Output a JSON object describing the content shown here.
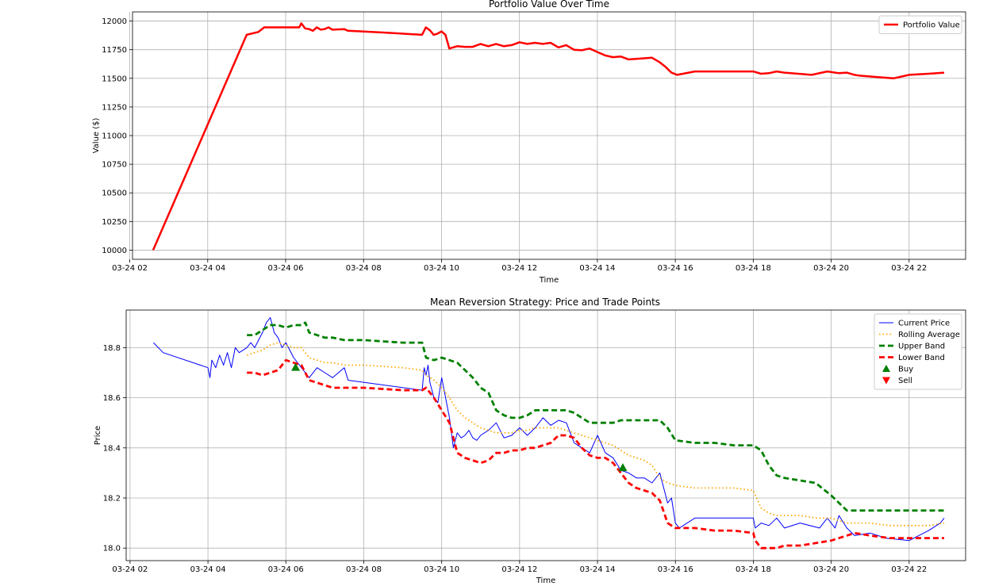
{
  "chart_data": [
    {
      "type": "line",
      "title": "Portfolio Value Over Time",
      "xlabel": "Time",
      "ylabel": "Value ($)",
      "ylim": [
        9920,
        12080
      ],
      "xlim": [
        2.07,
        23.45
      ],
      "x_ticks": [
        2,
        4,
        6,
        8,
        10,
        12,
        14,
        16,
        18,
        20,
        22
      ],
      "x_tick_labels": [
        "03-24 02",
        "03-24 04",
        "03-24 06",
        "03-24 08",
        "03-24 10",
        "03-24 12",
        "03-24 14",
        "03-24 16",
        "03-24 18",
        "03-24 20",
        "03-24 22"
      ],
      "y_ticks": [
        10000,
        10250,
        10500,
        10750,
        11000,
        11250,
        11500,
        11750,
        12000
      ],
      "y_tick_labels": [
        "10000",
        "10250",
        "10500",
        "10750",
        "11000",
        "11250",
        "11500",
        "11750",
        "12000"
      ],
      "grid": true,
      "legend_position": "top-right",
      "series": [
        {
          "name": "Portfolio Value",
          "color": "#ff0000",
          "x": [
            2.6,
            5.0,
            5.3,
            5.45,
            6.35,
            6.4,
            6.5,
            6.6,
            6.7,
            6.8,
            6.9,
            7.0,
            7.1,
            7.2,
            7.5,
            7.6,
            8.5,
            9.5,
            9.6,
            9.7,
            9.8,
            9.9,
            10.0,
            10.1,
            10.2,
            10.4,
            10.6,
            10.8,
            11.0,
            11.2,
            11.4,
            11.6,
            11.8,
            12.0,
            12.2,
            12.4,
            12.6,
            12.8,
            13.0,
            13.2,
            13.4,
            13.6,
            13.8,
            14.0,
            14.2,
            14.4,
            14.6,
            14.8,
            15.0,
            15.4,
            15.6,
            15.75,
            15.9,
            16.05,
            16.5,
            17.0,
            17.5,
            18.0,
            18.2,
            18.4,
            18.6,
            18.8,
            19.5,
            19.9,
            20.2,
            20.4,
            20.6,
            20.7,
            21.2,
            21.6,
            22.0,
            22.5,
            22.9
          ],
          "values": [
            10000,
            11880,
            11905,
            11945,
            11945,
            11980,
            11935,
            11930,
            11915,
            11945,
            11925,
            11930,
            11945,
            11925,
            11930,
            11915,
            11900,
            11880,
            11945,
            11920,
            11880,
            11890,
            11910,
            11880,
            11760,
            11780,
            11775,
            11775,
            11800,
            11780,
            11800,
            11780,
            11790,
            11815,
            11800,
            11810,
            11800,
            11810,
            11770,
            11790,
            11750,
            11745,
            11760,
            11730,
            11700,
            11685,
            11690,
            11665,
            11670,
            11680,
            11640,
            11600,
            11550,
            11530,
            11560,
            11560,
            11560,
            11560,
            11540,
            11545,
            11560,
            11550,
            11530,
            11560,
            11545,
            11550,
            11530,
            11525,
            11510,
            11500,
            11530,
            11540,
            11550
          ]
        }
      ]
    },
    {
      "type": "line",
      "title": "Mean Reversion Strategy: Price and Trade Points",
      "xlabel": "Time",
      "ylabel": "Price",
      "ylim": [
        17.95,
        18.95
      ],
      "xlim": [
        1.9,
        23.45
      ],
      "x_ticks": [
        2,
        4,
        6,
        8,
        10,
        12,
        14,
        16,
        18,
        20,
        22
      ],
      "x_tick_labels": [
        "03-24 02",
        "03-24 04",
        "03-24 06",
        "03-24 08",
        "03-24 10",
        "03-24 12",
        "03-24 14",
        "03-24 16",
        "03-24 18",
        "03-24 20",
        "03-24 22"
      ],
      "y_ticks": [
        18.0,
        18.2,
        18.4,
        18.6,
        18.8
      ],
      "y_tick_labels": [
        "18.0",
        "18.2",
        "18.4",
        "18.6",
        "18.8"
      ],
      "grid": true,
      "legend_position": "top-right",
      "series": [
        {
          "name": "Current Price",
          "color": "#0000ff",
          "style": "solid-thin",
          "x": [
            2.6,
            2.85,
            4.0,
            4.05,
            4.1,
            4.2,
            4.3,
            4.4,
            4.5,
            4.6,
            4.7,
            4.8,
            5.0,
            5.1,
            5.2,
            5.3,
            5.4,
            5.5,
            5.6,
            5.7,
            5.8,
            5.9,
            6.0,
            6.2,
            6.4,
            6.6,
            6.8,
            7.0,
            7.2,
            7.5,
            7.6,
            9.5,
            9.55,
            9.6,
            9.65,
            9.7,
            9.8,
            9.9,
            10.0,
            10.1,
            10.2,
            10.3,
            10.4,
            10.5,
            10.6,
            10.7,
            10.8,
            10.9,
            11.0,
            11.2,
            11.4,
            11.6,
            11.8,
            12.0,
            12.2,
            12.4,
            12.6,
            12.8,
            13.0,
            13.2,
            13.4,
            13.6,
            13.8,
            14.0,
            14.2,
            14.4,
            14.6,
            14.8,
            15.0,
            15.2,
            15.4,
            15.6,
            15.8,
            15.9,
            16.0,
            16.1,
            16.5,
            17.0,
            17.5,
            18.0,
            18.05,
            18.2,
            18.4,
            18.6,
            18.8,
            19.2,
            19.7,
            19.9,
            20.1,
            20.2,
            20.4,
            20.6,
            21.0,
            21.4,
            22.0,
            22.5,
            22.8,
            22.9
          ],
          "values": [
            18.82,
            18.78,
            18.72,
            18.68,
            18.75,
            18.72,
            18.77,
            18.73,
            18.78,
            18.72,
            18.8,
            18.78,
            18.8,
            18.82,
            18.8,
            18.83,
            18.86,
            18.9,
            18.92,
            18.86,
            18.84,
            18.8,
            18.82,
            18.76,
            18.72,
            18.68,
            18.72,
            18.7,
            18.68,
            18.72,
            18.67,
            18.63,
            18.72,
            18.69,
            18.73,
            18.66,
            18.6,
            18.58,
            18.68,
            18.6,
            18.52,
            18.4,
            18.46,
            18.44,
            18.45,
            18.47,
            18.44,
            18.43,
            18.45,
            18.47,
            18.5,
            18.44,
            18.45,
            18.48,
            18.45,
            18.48,
            18.52,
            18.49,
            18.51,
            18.5,
            18.42,
            18.4,
            18.38,
            18.45,
            18.38,
            18.36,
            18.31,
            18.3,
            18.28,
            18.28,
            18.26,
            18.3,
            18.18,
            18.2,
            18.1,
            18.08,
            18.12,
            18.12,
            18.12,
            18.12,
            18.08,
            18.1,
            18.09,
            18.12,
            18.08,
            18.1,
            18.08,
            18.12,
            18.08,
            18.13,
            18.08,
            18.05,
            18.06,
            18.04,
            18.03,
            18.07,
            18.1,
            18.12
          ]
        },
        {
          "name": "Rolling Average",
          "color": "#ffa500",
          "style": "dotted",
          "x": [
            5.0,
            5.2,
            5.4,
            5.6,
            5.8,
            6.0,
            6.2,
            6.4,
            6.5,
            6.6,
            6.8,
            7.0,
            7.2,
            7.5,
            8.0,
            9.0,
            9.5,
            9.6,
            9.8,
            10.0,
            10.2,
            10.4,
            10.6,
            10.8,
            11.0,
            11.2,
            11.4,
            11.6,
            11.8,
            12.0,
            12.2,
            12.4,
            12.6,
            12.8,
            13.0,
            13.2,
            13.4,
            13.6,
            13.8,
            14.0,
            14.2,
            14.4,
            14.6,
            14.8,
            15.0,
            15.2,
            15.4,
            15.6,
            15.8,
            16.0,
            16.5,
            17.0,
            17.5,
            18.0,
            18.2,
            18.4,
            18.6,
            18.8,
            19.2,
            19.6,
            20.0,
            20.2,
            20.4,
            20.6,
            21.0,
            21.5,
            22.0,
            22.5,
            22.9
          ],
          "values": [
            18.77,
            18.78,
            18.79,
            18.81,
            18.82,
            18.81,
            18.8,
            18.8,
            18.78,
            18.76,
            18.75,
            18.74,
            18.74,
            18.73,
            18.73,
            18.72,
            18.71,
            18.69,
            18.67,
            18.64,
            18.6,
            18.55,
            18.52,
            18.5,
            18.48,
            18.47,
            18.46,
            18.46,
            18.46,
            18.47,
            18.47,
            18.48,
            18.48,
            18.48,
            18.48,
            18.47,
            18.46,
            18.45,
            18.44,
            18.43,
            18.42,
            18.41,
            18.39,
            18.37,
            18.36,
            18.35,
            18.33,
            18.28,
            18.26,
            18.25,
            18.24,
            18.24,
            18.24,
            18.23,
            18.16,
            18.14,
            18.13,
            18.13,
            18.13,
            18.12,
            18.12,
            18.11,
            18.1,
            18.1,
            18.1,
            18.09,
            18.09,
            18.09,
            18.1
          ]
        },
        {
          "name": "Upper Band",
          "color": "#008000",
          "style": "dashed",
          "x": [
            5.0,
            5.2,
            5.4,
            5.6,
            5.8,
            6.0,
            6.2,
            6.4,
            6.5,
            6.6,
            6.8,
            7.0,
            7.2,
            7.5,
            8.0,
            9.0,
            9.5,
            9.6,
            9.8,
            10.0,
            10.2,
            10.4,
            10.6,
            10.8,
            11.0,
            11.2,
            11.4,
            11.6,
            11.8,
            12.0,
            12.2,
            12.4,
            12.6,
            12.8,
            13.0,
            13.2,
            13.4,
            13.6,
            13.8,
            14.0,
            14.2,
            14.4,
            14.6,
            14.8,
            15.0,
            15.2,
            15.4,
            15.6,
            15.8,
            16.0,
            16.5,
            17.0,
            17.5,
            18.0,
            18.2,
            18.4,
            18.6,
            18.8,
            19.2,
            19.6,
            20.0,
            20.2,
            20.4,
            20.6,
            21.0,
            21.5,
            22.0,
            22.5,
            22.9
          ],
          "values": [
            18.85,
            18.85,
            18.87,
            18.89,
            18.89,
            18.88,
            18.89,
            18.89,
            18.9,
            18.86,
            18.85,
            18.84,
            18.84,
            18.83,
            18.83,
            18.82,
            18.82,
            18.76,
            18.75,
            18.76,
            18.75,
            18.74,
            18.71,
            18.68,
            18.64,
            18.62,
            18.55,
            18.53,
            18.52,
            18.52,
            18.53,
            18.55,
            18.55,
            18.55,
            18.55,
            18.55,
            18.54,
            18.52,
            18.5,
            18.5,
            18.5,
            18.5,
            18.51,
            18.51,
            18.51,
            18.51,
            18.51,
            18.51,
            18.48,
            18.43,
            18.42,
            18.42,
            18.41,
            18.41,
            18.39,
            18.33,
            18.29,
            18.28,
            18.27,
            18.26,
            18.21,
            18.18,
            18.15,
            18.15,
            18.15,
            18.15,
            18.15,
            18.15,
            18.15
          ]
        },
        {
          "name": "Lower Band",
          "color": "#ff0000",
          "style": "dashed",
          "x": [
            5.0,
            5.2,
            5.4,
            5.6,
            5.8,
            6.0,
            6.2,
            6.4,
            6.5,
            6.6,
            6.8,
            7.0,
            7.2,
            7.5,
            8.0,
            9.0,
            9.5,
            9.6,
            9.8,
            10.0,
            10.2,
            10.4,
            10.6,
            10.8,
            11.0,
            11.2,
            11.4,
            11.6,
            11.8,
            12.0,
            12.2,
            12.4,
            12.6,
            12.8,
            13.0,
            13.2,
            13.4,
            13.6,
            13.8,
            14.0,
            14.2,
            14.4,
            14.6,
            14.8,
            15.0,
            15.2,
            15.4,
            15.6,
            15.8,
            16.0,
            16.5,
            17.0,
            17.5,
            18.0,
            18.05,
            18.2,
            18.4,
            18.6,
            18.8,
            19.2,
            19.6,
            20.0,
            20.2,
            20.4,
            20.6,
            21.0,
            21.5,
            22.0,
            22.5,
            22.9
          ],
          "values": [
            18.7,
            18.7,
            18.69,
            18.7,
            18.71,
            18.75,
            18.74,
            18.73,
            18.7,
            18.67,
            18.66,
            18.65,
            18.64,
            18.64,
            18.64,
            18.63,
            18.63,
            18.64,
            18.6,
            18.55,
            18.5,
            18.38,
            18.36,
            18.35,
            18.34,
            18.35,
            18.38,
            18.38,
            18.39,
            18.39,
            18.4,
            18.4,
            18.41,
            18.42,
            18.45,
            18.45,
            18.44,
            18.4,
            18.37,
            18.36,
            18.36,
            18.34,
            18.3,
            18.26,
            18.24,
            18.23,
            18.22,
            18.19,
            18.1,
            18.08,
            18.08,
            18.07,
            18.07,
            18.06,
            18.03,
            18.0,
            18.0,
            18.0,
            18.01,
            18.01,
            18.02,
            18.03,
            18.04,
            18.05,
            18.06,
            18.05,
            18.04,
            18.04,
            18.04,
            18.04
          ]
        }
      ],
      "markers": [
        {
          "name": "Buy",
          "color": "#008000",
          "shape": "triangle-up",
          "points": [
            [
              6.25,
              18.72
            ],
            [
              14.65,
              18.32
            ]
          ]
        },
        {
          "name": "Sell",
          "color": "#ff0000",
          "shape": "triangle-down",
          "points": []
        }
      ]
    }
  ]
}
